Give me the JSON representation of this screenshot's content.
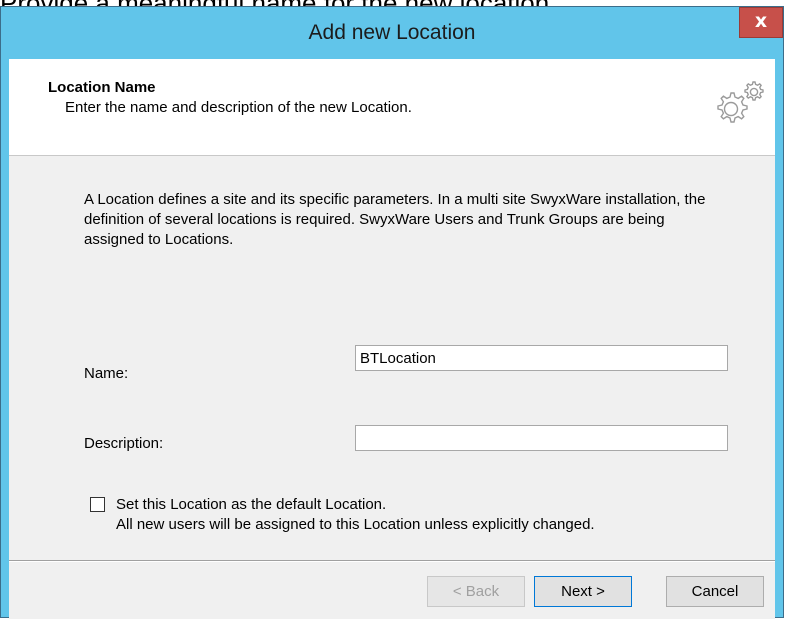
{
  "caption": "Provide a meaningful name for the new location.",
  "window": {
    "title": "Add new Location",
    "close_glyph": "x",
    "close_icon": "close-icon"
  },
  "header": {
    "title": "Location Name",
    "subtitle": "Enter the name and description of the new Location.",
    "icon": "gears-icon"
  },
  "intro": "A Location defines a site and its specific parameters. In a multi site SwyxWare installation, the definition of several locations is required. SwyxWare Users and Trunk Groups are being assigned to Locations.",
  "form": {
    "name_label": "Name:",
    "name_value": "BTLocation",
    "description_label": "Description:",
    "description_value": ""
  },
  "default_option": {
    "checked": false,
    "label": "Set this Location as the default Location.",
    "note": "All new users will be assigned to this Location unless explicitly changed."
  },
  "buttons": {
    "back": "< Back",
    "next": "Next >",
    "cancel": "Cancel"
  },
  "colors": {
    "titlebar": "#61c5ea",
    "close": "#c7504a",
    "client": "#f0f0f0"
  }
}
